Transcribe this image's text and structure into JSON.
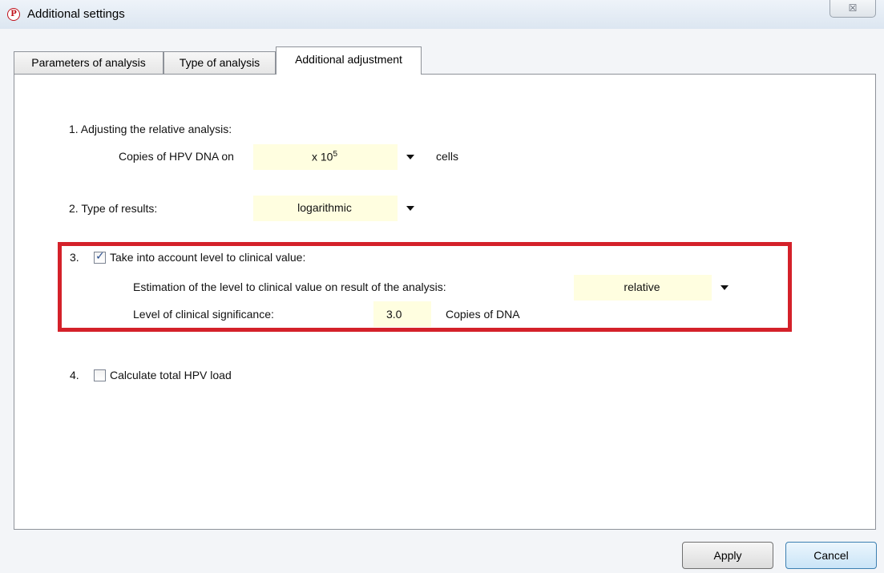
{
  "window": {
    "title": "Additional settings",
    "close_glyph": "☒"
  },
  "tabs": [
    {
      "label": "Parameters of analysis",
      "active": false
    },
    {
      "label": "Type of analysis",
      "active": false
    },
    {
      "label": "Additional adjustment",
      "active": true
    }
  ],
  "section1": {
    "heading": "1. Adjusting the relative analysis:",
    "prefix": "Copies of HPV DNA on",
    "combo_value": "x 10",
    "combo_exponent": "5",
    "suffix": "cells"
  },
  "section2": {
    "label": "2. Type of results:",
    "combo_value": "logarithmic"
  },
  "section3": {
    "number": "3.",
    "checkbox_label": "Take into account level to clinical value:",
    "checked": true,
    "estimation_label": "Estimation of the level to clinical value on result of the analysis:",
    "estimation_value": "relative",
    "significance_label": "Level of clinical significance:",
    "significance_value": "3.0",
    "significance_unit": "Copies of DNA"
  },
  "section4": {
    "number": "4.",
    "checkbox_label": "Calculate total HPV load",
    "checked": false
  },
  "buttons": {
    "apply": "Apply",
    "cancel": "Cancel"
  },
  "colors": {
    "highlight": "#d4212a",
    "field_background": "#fffee0"
  }
}
